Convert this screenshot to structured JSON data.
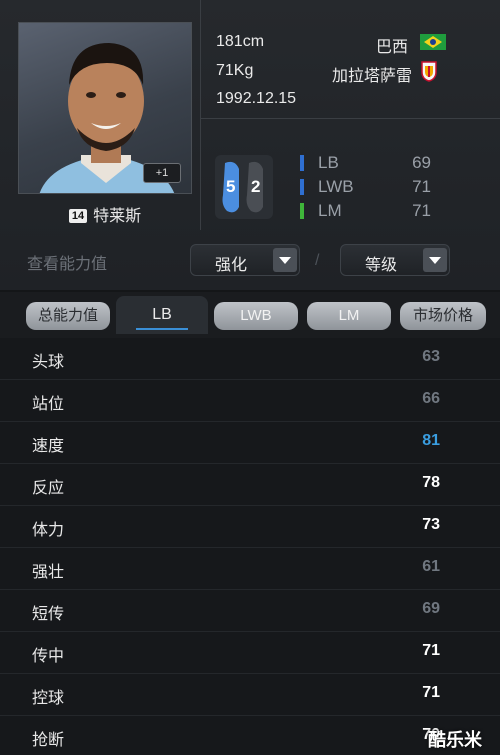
{
  "player": {
    "height": "181cm",
    "weight": "71Kg",
    "birthdate": "1992.12.15",
    "nation": "巴西",
    "club": "加拉塔萨雷",
    "name": "特莱斯",
    "number": "14",
    "plus_badge": "+1"
  },
  "positions": {
    "card_digits": [
      "5",
      "2"
    ],
    "list": [
      {
        "label": "LB",
        "value": "69",
        "color": "#2f6fd1"
      },
      {
        "label": "LWB",
        "value": "71",
        "color": "#2f6fd1"
      },
      {
        "label": "LM",
        "value": "71",
        "color": "#3fb53a"
      }
    ]
  },
  "filter": {
    "label": "查看能力值",
    "dropdown1": "强化",
    "dropdown2": "等级",
    "separator": "/"
  },
  "tabs": [
    "总能力值",
    "LB",
    "LWB",
    "LM",
    "市场价格"
  ],
  "stats": [
    {
      "name": "头球",
      "value": "63",
      "color": "#707780"
    },
    {
      "name": "站位",
      "value": "66",
      "color": "#707780"
    },
    {
      "name": "速度",
      "value": "81",
      "color": "#3a9de0"
    },
    {
      "name": "反应",
      "value": "78",
      "color": "#ffffff"
    },
    {
      "name": "体力",
      "value": "73",
      "color": "#ffffff"
    },
    {
      "name": "强壮",
      "value": "61",
      "color": "#707780"
    },
    {
      "name": "短传",
      "value": "69",
      "color": "#707780"
    },
    {
      "name": "传中",
      "value": "71",
      "color": "#ffffff"
    },
    {
      "name": "控球",
      "value": "71",
      "color": "#ffffff"
    },
    {
      "name": "抢断",
      "value": "70",
      "color": "#ffffff"
    }
  ],
  "watermark": "酷乐米"
}
